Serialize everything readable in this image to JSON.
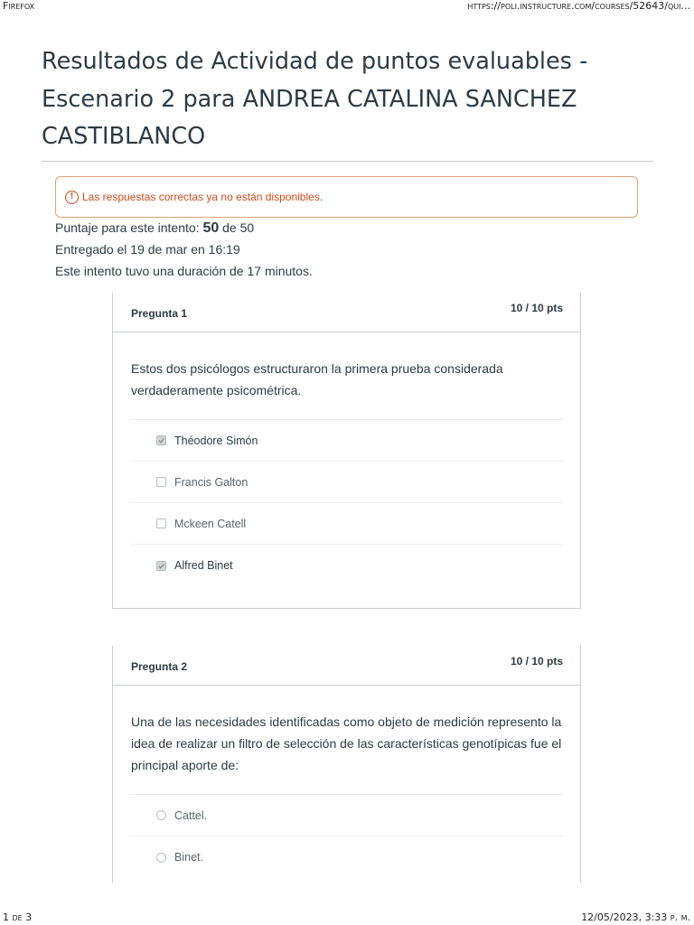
{
  "print": {
    "browser": "Firefox",
    "url": "https://poli.instructure.com/courses/52643/qui...",
    "page_indicator": "1 de 3",
    "datetime": "12/05/2023, 3:33 p. m."
  },
  "page_title": "Resultados de Actividad de puntos evaluables - Escenario 2 para ANDREA CATALINA SANCHEZ CASTIBLANCO",
  "alert": {
    "icon": "exclamation-circle-icon",
    "text": "Las respuestas correctas ya no están disponibles.",
    "color": "#d24a1b"
  },
  "attempt": {
    "score_label": "Puntaje para este intento:",
    "score": "50",
    "score_of": "de 50",
    "submitted": "Entregado el 19 de mar en 16:19",
    "duration": "Este intento tuvo una duración de 17 minutos."
  },
  "questions": [
    {
      "name": "Pregunta 1",
      "points": "10 / 10 pts",
      "text": "Estos dos psicólogos estructuraron la primera prueba considerada verdaderamente psicométrica.",
      "answer_type": "checkbox",
      "answers": [
        {
          "label": "Théodore Simón",
          "selected": true
        },
        {
          "label": "Francis Galton",
          "selected": false
        },
        {
          "label": "Mckeen Catell",
          "selected": false
        },
        {
          "label": "Alfred Binet",
          "selected": true
        }
      ]
    },
    {
      "name": "Pregunta 2",
      "points": "10 / 10 pts",
      "text": "Una de las necesidades identificadas como objeto de medición represento la idea de realizar un filtro de selección de las características genotípicas fue el principal aporte de:",
      "answer_type": "radio",
      "answers": [
        {
          "label": "Cattel.",
          "selected": false
        },
        {
          "label": "Binet.",
          "selected": false
        }
      ]
    }
  ]
}
